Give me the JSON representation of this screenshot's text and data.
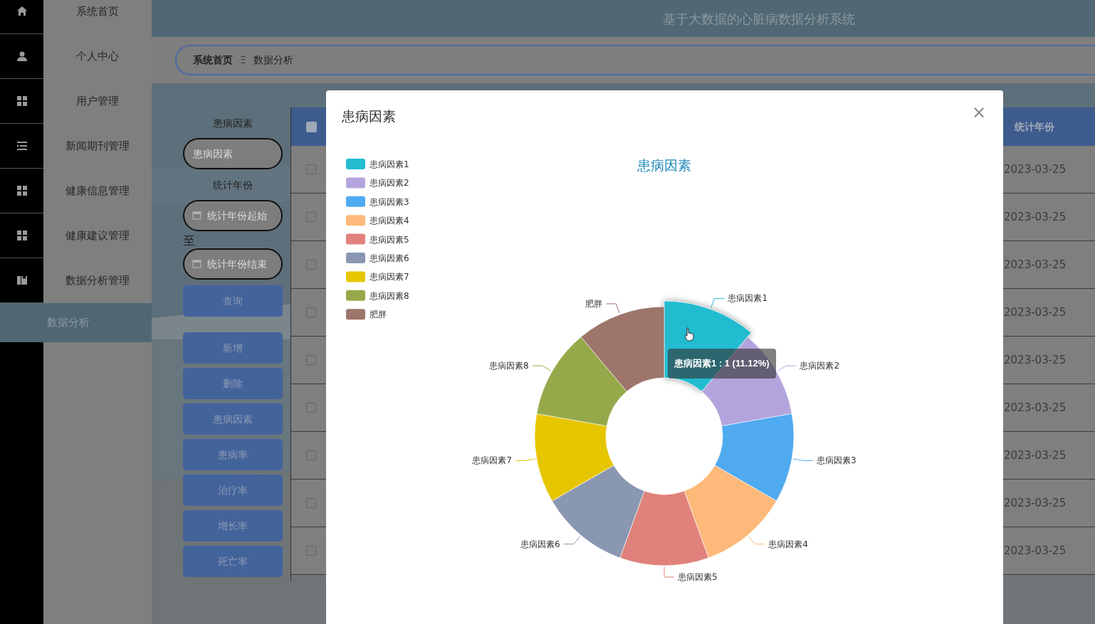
{
  "header": {
    "title": "基于大数据的心脏病数据分析系统"
  },
  "sidebar": {
    "items": [
      {
        "label": "系统首页",
        "selected": false
      },
      {
        "label": "个人中心",
        "selected": false
      },
      {
        "label": "用户管理",
        "selected": false
      },
      {
        "label": "新闻期刊管理",
        "selected": false
      },
      {
        "label": "健康信息管理",
        "selected": false
      },
      {
        "label": "健康建议管理",
        "selected": false
      },
      {
        "label": "数据分析管理",
        "selected": false,
        "expanded": true,
        "children": [
          {
            "label": "数据分析",
            "selected": true
          }
        ]
      }
    ]
  },
  "breadcrumb": {
    "items": [
      "系统首页",
      "数据分析"
    ],
    "separator": "Ξ"
  },
  "search": {
    "fields": [
      {
        "kind": "text",
        "label": "患病因素",
        "placeholder": "患病因素"
      },
      {
        "kind": "date",
        "label": "统计年份",
        "placeholder": "统计年份起始"
      },
      {
        "kind": "date_end",
        "label": "至",
        "placeholder": "统计年份结束"
      }
    ],
    "query_button": "查询",
    "buttons": [
      "新增",
      "删除",
      "患病因素",
      "患病率",
      "治疗率",
      "增长率",
      "死亡率"
    ]
  },
  "table": {
    "select_all": {
      "checked": false
    },
    "column_label": "统计年份",
    "rows": [
      {
        "checked": false,
        "stat_year": "2023-03-25"
      },
      {
        "checked": false,
        "stat_year": "2023-03-25"
      },
      {
        "checked": false,
        "stat_year": "2023-03-25"
      },
      {
        "checked": false,
        "stat_year": "2023-03-25"
      },
      {
        "checked": false,
        "stat_year": "2023-03-25"
      },
      {
        "checked": false,
        "stat_year": "2023-03-25"
      },
      {
        "checked": false,
        "stat_year": "2023-03-25"
      },
      {
        "checked": false,
        "stat_year": "2023-03-25"
      },
      {
        "checked": false,
        "stat_year": "2023-03-25"
      }
    ]
  },
  "modal": {
    "title": "患病因素",
    "close": "×",
    "legend": [
      "患病因素1",
      "患病因素2",
      "患病因素3",
      "患病因素4",
      "患病因素5",
      "患病因素6",
      "患病因素7",
      "患病因素8",
      "肥胖"
    ],
    "slices": [
      {
        "color": "#23bcd1",
        "hovered": true
      },
      {
        "color": "#b3a4dd",
        "hovered": false
      },
      {
        "color": "#4faaf0",
        "hovered": false
      },
      {
        "color": "#fdb97a",
        "hovered": false
      },
      {
        "color": "#e0827b",
        "hovered": false
      },
      {
        "color": "#8997b1",
        "hovered": false
      },
      {
        "color": "#e6c600",
        "hovered": false
      },
      {
        "color": "#96a94a",
        "hovered": false
      },
      {
        "color": "#9d756b",
        "hovered": false
      }
    ],
    "tooltip": "患病因素1 : 1 (11.12%)",
    "chart_data": {
      "type": "donut",
      "title": "患病因素",
      "categories": [
        "患病因素1",
        "患病因素2",
        "患病因素3",
        "患病因素4",
        "患病因素5",
        "患病因素6",
        "患病因素7",
        "患病因素8",
        "肥胖"
      ],
      "values": [
        1,
        1,
        1,
        1,
        1,
        1,
        1,
        1,
        1
      ]
    }
  }
}
